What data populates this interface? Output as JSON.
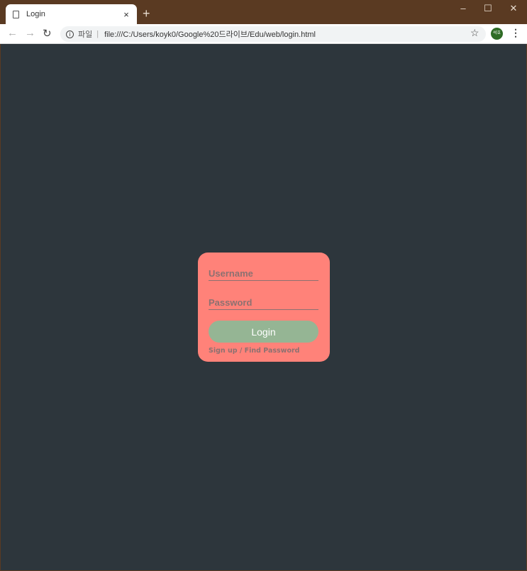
{
  "browser": {
    "tab": {
      "title": "Login",
      "icon": "document-icon",
      "close_glyph": "×"
    },
    "new_tab_glyph": "+",
    "window_controls": {
      "minimize": "–",
      "maximize": "☐",
      "close": "✕"
    },
    "nav": {
      "back": "←",
      "forward": "→",
      "reload": "↻"
    },
    "address": {
      "info_glyph": "i",
      "scheme_label": "파일",
      "separator": "|",
      "url": "file:///C:/Users/koyk0/Google%20드라이브/Edu/web/login.html"
    },
    "bookmark_glyph": "☆",
    "profile_initials": "석호",
    "menu_glyph": "⋮"
  },
  "login": {
    "username_placeholder": "Username",
    "username_value": "",
    "password_placeholder": "Password",
    "password_value": "",
    "submit_label": "Login",
    "signup_label": "Sign up",
    "links_separator": " / ",
    "find_password_label": "Find Password"
  },
  "colors": {
    "page_background": "#2d363c",
    "card_background": "#ff8279",
    "button_background": "#95b594",
    "muted_text": "#8c7171",
    "titlebar": "#5a3a22"
  }
}
